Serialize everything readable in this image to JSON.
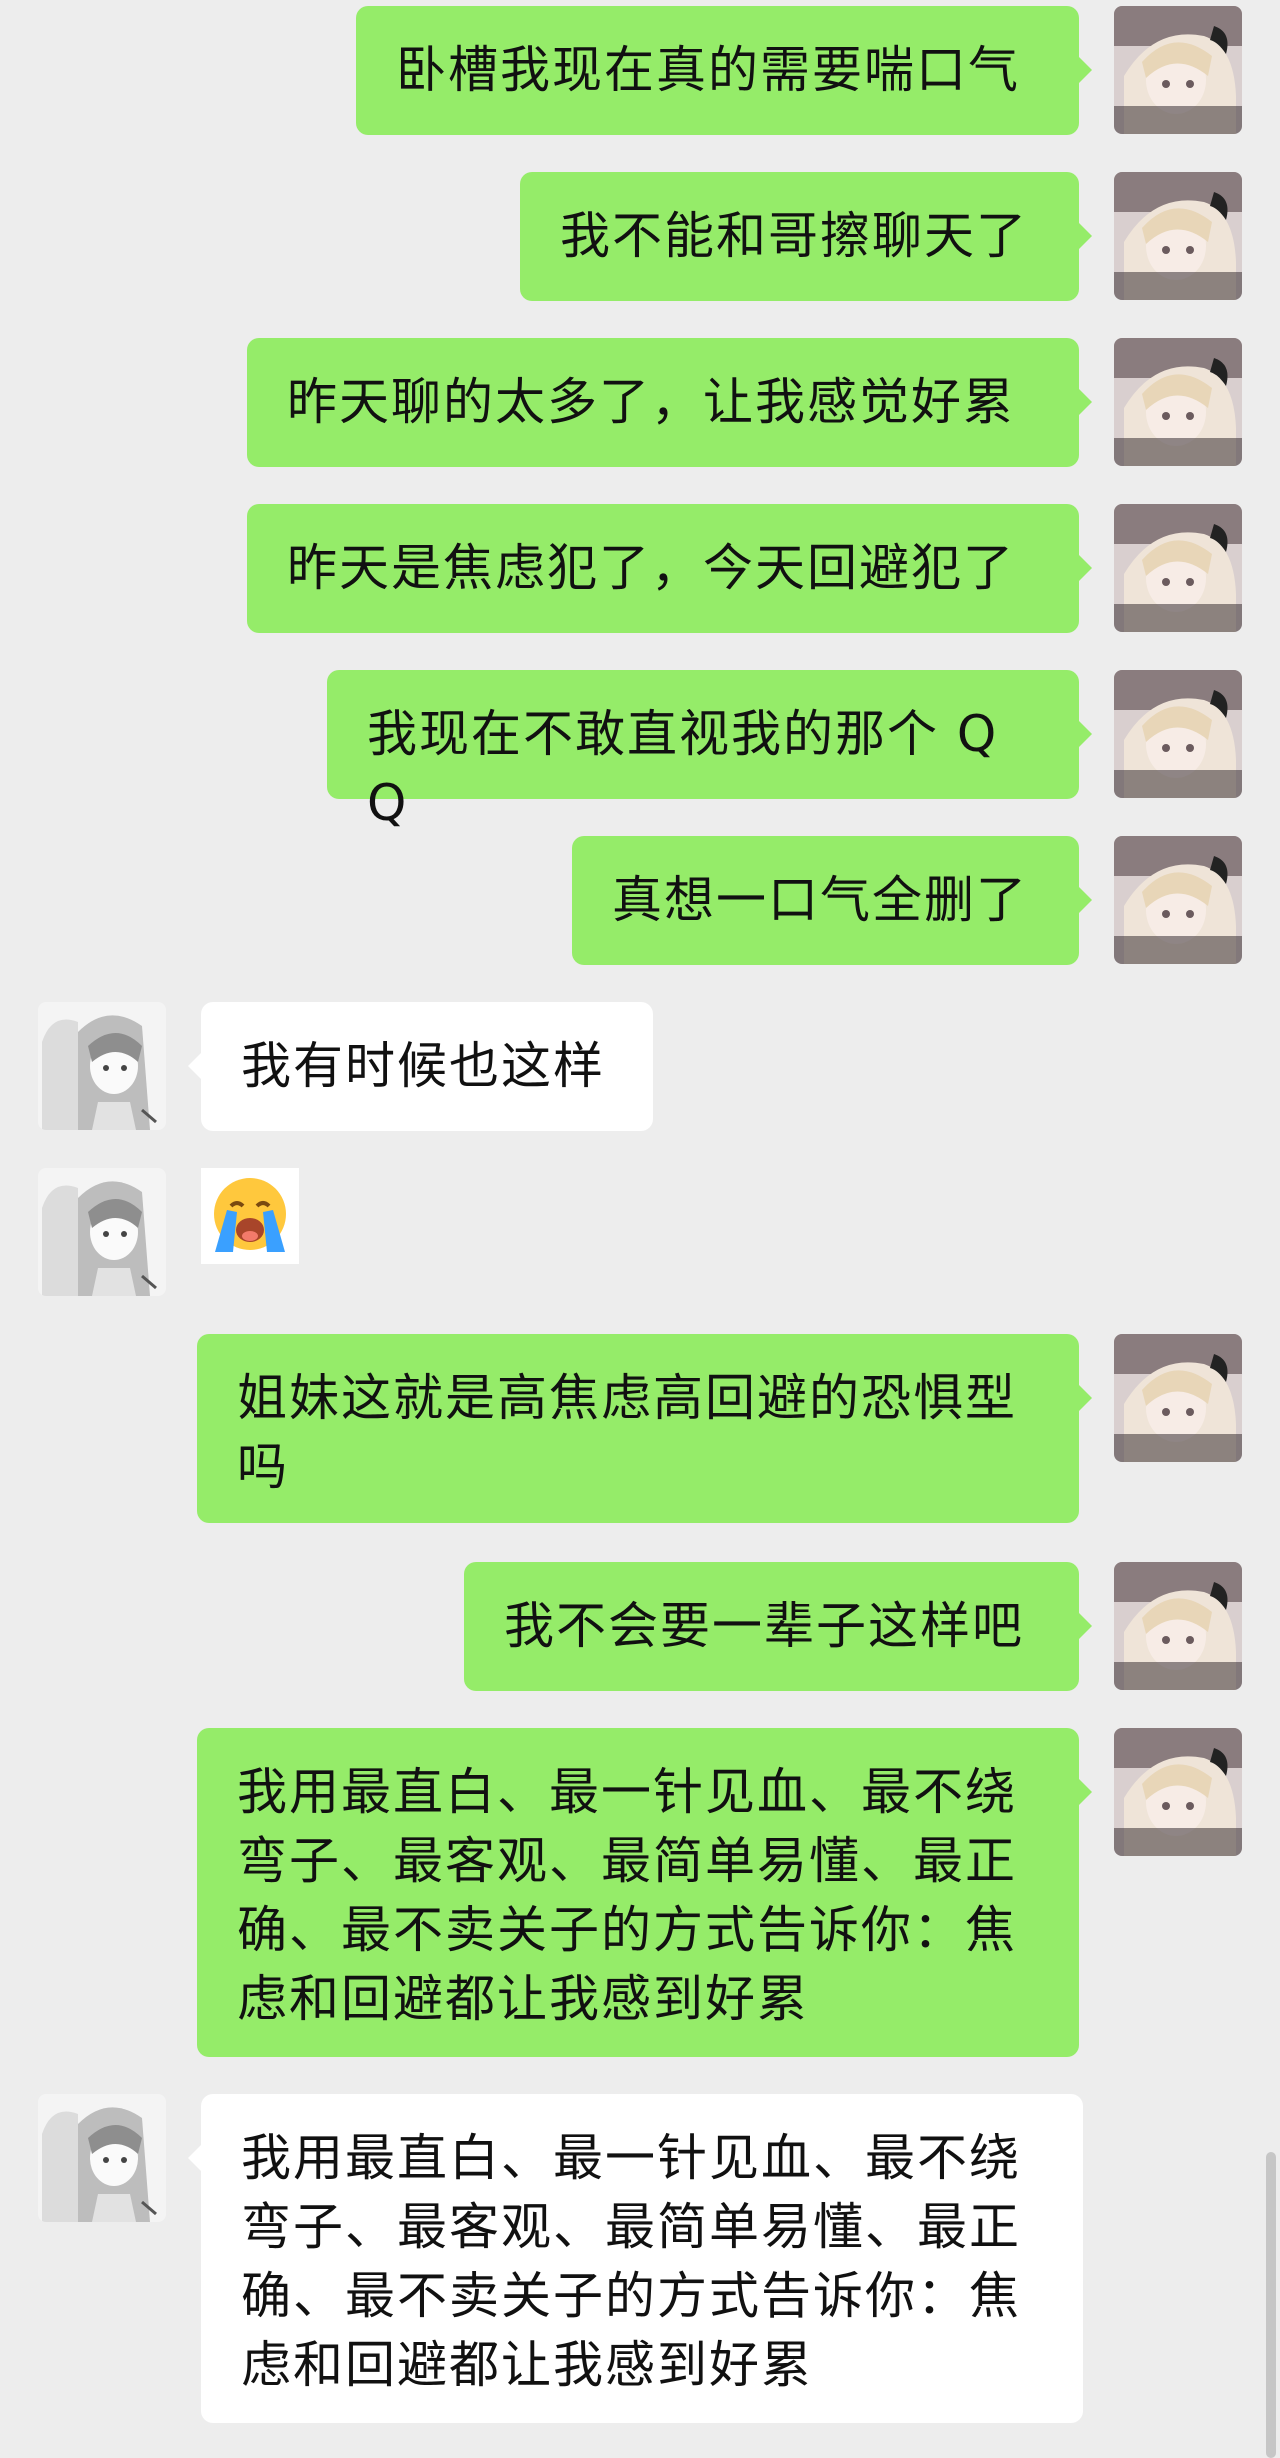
{
  "chat": {
    "messages": [
      {
        "side": "out",
        "text": "卧槽我现在真的需要喘口气"
      },
      {
        "side": "out",
        "text": "我不能和哥擦聊天了"
      },
      {
        "side": "out",
        "text": "昨天聊的太多了，让我感觉好累"
      },
      {
        "side": "out",
        "text": "昨天是焦虑犯了，今天回避犯了"
      },
      {
        "side": "out",
        "text": "我现在不敢直视我的那个 QQ"
      },
      {
        "side": "out",
        "text": "真想一口气全删了"
      },
      {
        "side": "in",
        "text": "我有时候也这样"
      },
      {
        "side": "in",
        "sticker": "crying-face-emoji"
      },
      {
        "side": "out",
        "text": "姐妹这就是高焦虑高回避的恐惧型吗"
      },
      {
        "side": "out",
        "text": "我不会要一辈子这样吧"
      },
      {
        "side": "out",
        "text": "我用最直白、最一针见血、最不绕弯子、最客观、最简单易懂、最正确、最不卖关子的方式告诉你：焦虑和回避都让我感到好累"
      },
      {
        "side": "in",
        "text": "我用最直白、最一针见血、最不绕弯子、最客观、最简单易懂、最正确、最不卖关子的方式告诉你：焦虑和回避都让我感到好累"
      }
    ]
  },
  "colors": {
    "background": "#ededed",
    "outgoing_bubble": "#95ec69",
    "incoming_bubble": "#ffffff"
  }
}
